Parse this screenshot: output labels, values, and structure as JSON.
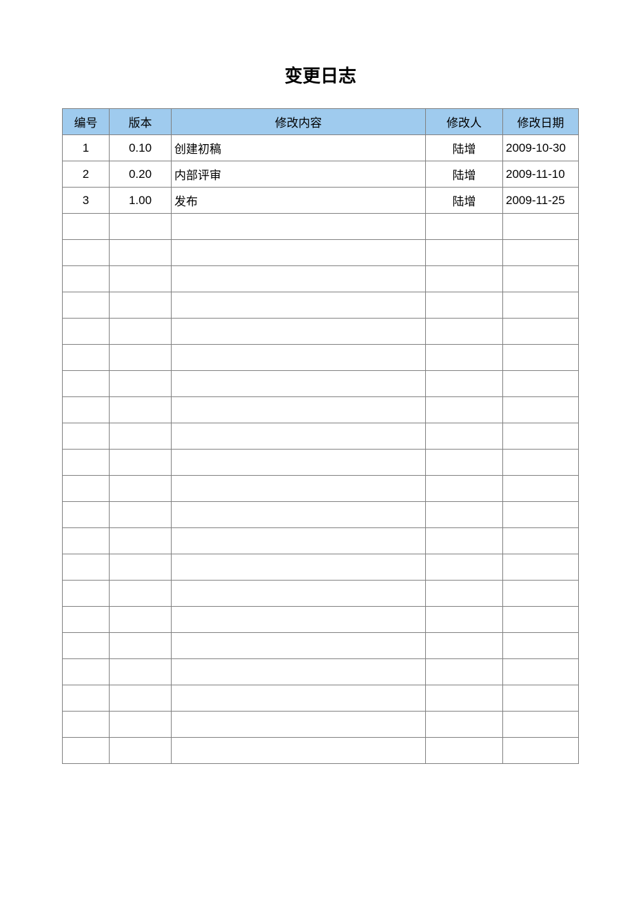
{
  "title": "变更日志",
  "headers": {
    "id": "编号",
    "version": "版本",
    "desc": "修改内容",
    "author": "修改人",
    "date": "修改日期"
  },
  "rows": [
    {
      "id": "1",
      "version": "0.10",
      "desc": "创建初稿",
      "author": "陆增",
      "date": "2009-10-30"
    },
    {
      "id": "2",
      "version": "0.20",
      "desc": "内部评审",
      "author": "陆增",
      "date": "2009-11-10"
    },
    {
      "id": "3",
      "version": "1.00",
      "desc": "发布",
      "author": "陆增",
      "date": "2009-11-25"
    },
    {
      "id": "",
      "version": "",
      "desc": "",
      "author": "",
      "date": ""
    },
    {
      "id": "",
      "version": "",
      "desc": "",
      "author": "",
      "date": ""
    },
    {
      "id": "",
      "version": "",
      "desc": "",
      "author": "",
      "date": ""
    },
    {
      "id": "",
      "version": "",
      "desc": "",
      "author": "",
      "date": ""
    },
    {
      "id": "",
      "version": "",
      "desc": "",
      "author": "",
      "date": ""
    },
    {
      "id": "",
      "version": "",
      "desc": "",
      "author": "",
      "date": ""
    },
    {
      "id": "",
      "version": "",
      "desc": "",
      "author": "",
      "date": ""
    },
    {
      "id": "",
      "version": "",
      "desc": "",
      "author": "",
      "date": ""
    },
    {
      "id": "",
      "version": "",
      "desc": "",
      "author": "",
      "date": ""
    },
    {
      "id": "",
      "version": "",
      "desc": "",
      "author": "",
      "date": ""
    },
    {
      "id": "",
      "version": "",
      "desc": "",
      "author": "",
      "date": ""
    },
    {
      "id": "",
      "version": "",
      "desc": "",
      "author": "",
      "date": ""
    },
    {
      "id": "",
      "version": "",
      "desc": "",
      "author": "",
      "date": ""
    },
    {
      "id": "",
      "version": "",
      "desc": "",
      "author": "",
      "date": ""
    },
    {
      "id": "",
      "version": "",
      "desc": "",
      "author": "",
      "date": ""
    },
    {
      "id": "",
      "version": "",
      "desc": "",
      "author": "",
      "date": ""
    },
    {
      "id": "",
      "version": "",
      "desc": "",
      "author": "",
      "date": ""
    },
    {
      "id": "",
      "version": "",
      "desc": "",
      "author": "",
      "date": ""
    },
    {
      "id": "",
      "version": "",
      "desc": "",
      "author": "",
      "date": ""
    },
    {
      "id": "",
      "version": "",
      "desc": "",
      "author": "",
      "date": ""
    },
    {
      "id": "",
      "version": "",
      "desc": "",
      "author": "",
      "date": ""
    }
  ]
}
